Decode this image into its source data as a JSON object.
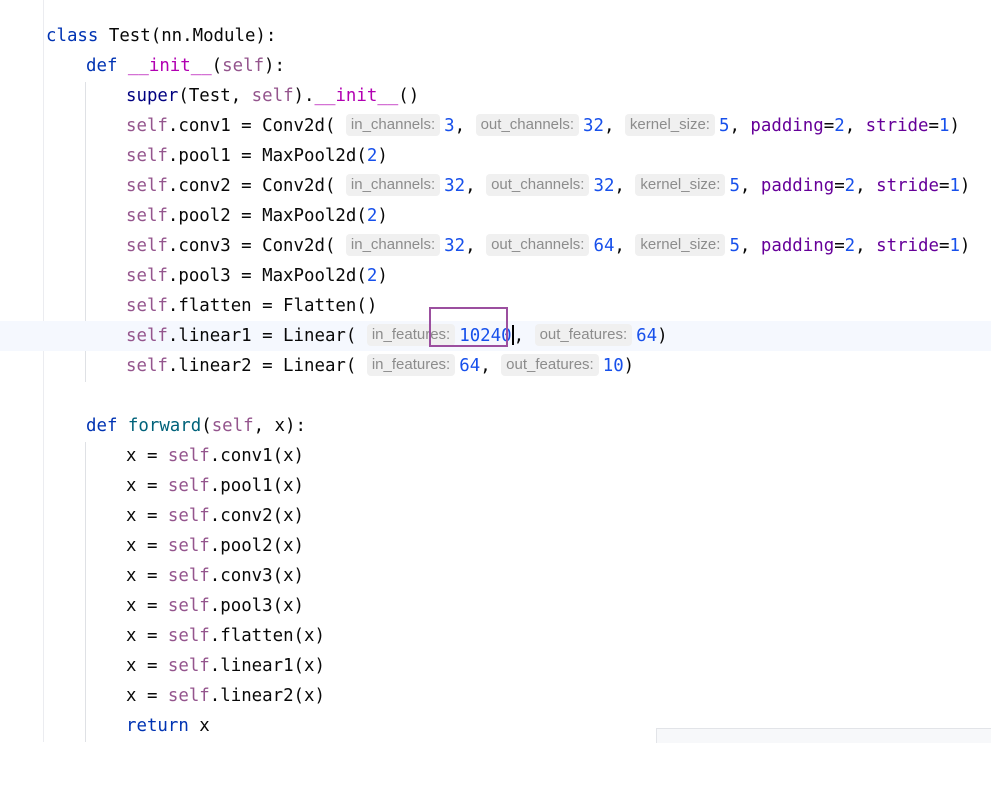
{
  "code": {
    "class_keyword": "class",
    "class_name": "Test",
    "class_base": "(nn.Module):",
    "def_keyword": "def",
    "init_name": "__init__",
    "init_open": "(",
    "self_word": "self",
    "init_close": "):",
    "super_call": "super",
    "super_args_a": "(Test, ",
    "super_args_b": ").",
    "super_init": "__init__",
    "super_tail": "()",
    "lines": [
      {
        "attr": ".conv1 = Conv2d(",
        "hint1": "in_channels:",
        "v1": "3",
        "hint2": "out_channels:",
        "v2": "32",
        "hint3": "kernel_size:",
        "v3": "5",
        "k1": "padding",
        "k1v": "2",
        "k2": "stride",
        "k2v": "1"
      },
      {
        "attr": ".pool1 = MaxPool2d(",
        "val": "2"
      },
      {
        "attr": ".conv2 = Conv2d(",
        "hint1": "in_channels:",
        "v1": "32",
        "hint2": "out_channels:",
        "v2": "32",
        "hint3": "kernel_size:",
        "v3": "5",
        "k1": "padding",
        "k1v": "2",
        "k2": "stride",
        "k2v": "1"
      },
      {
        "attr": ".pool2 = MaxPool2d(",
        "val": "2"
      },
      {
        "attr": ".conv3 = Conv2d(",
        "hint1": "in_channels:",
        "v1": "32",
        "hint2": "out_channels:",
        "v2": "64",
        "hint3": "kernel_size:",
        "v3": "5",
        "k1": "padding",
        "k1v": "2",
        "k2": "stride",
        "k2v": "1"
      },
      {
        "attr": ".pool3 = MaxPool2d(",
        "val": "2"
      },
      {
        "attr": ".flatten = Flatten()"
      },
      {
        "attr": ".linear1 = Linear(",
        "hint1": "in_features:",
        "v1": "10240",
        "hint2": "out_features:",
        "v2": "64"
      },
      {
        "attr": ".linear2 = Linear(",
        "hint1": "in_features:",
        "v1": "64",
        "hint2": "out_features:",
        "v2": "10"
      }
    ],
    "forward_name": "forward",
    "forward_params": ", x):",
    "forward_body": [
      ".conv1(x)",
      ".pool1(x)",
      ".conv2(x)",
      ".pool2(x)",
      ".conv3(x)",
      ".pool3(x)",
      ".flatten(x)",
      ".linear1(x)",
      ".linear2(x)"
    ],
    "x_assign": "x = ",
    "return_keyword": "return",
    "return_value": " x",
    "comma": ",",
    "close_paren": ")",
    "equals": "=",
    "open_paren": "("
  },
  "colors": {
    "keyword": "#0033b3",
    "self": "#94558d",
    "number": "#1750eb",
    "kwarg": "#660099",
    "function": "#00627a",
    "dunder": "#b200b2",
    "highlight_box": "#9b4f9f"
  }
}
